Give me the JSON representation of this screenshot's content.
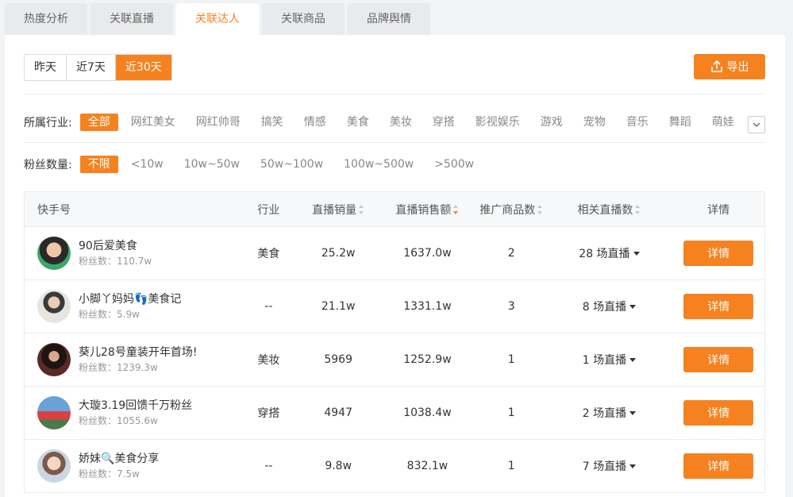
{
  "tabs": [
    {
      "label": "热度分析",
      "active": false
    },
    {
      "label": "关联直播",
      "active": false
    },
    {
      "label": "关联达人",
      "active": true
    },
    {
      "label": "关联商品",
      "active": false
    },
    {
      "label": "品牌舆情",
      "active": false
    }
  ],
  "date_range": {
    "options": [
      "昨天",
      "近7天",
      "近30天"
    ],
    "selected": "近30天"
  },
  "export_label": "导出",
  "industry_filter": {
    "label": "所属行业:",
    "options": [
      "全部",
      "网红美女",
      "网红帅哥",
      "搞笑",
      "情感",
      "美食",
      "美妆",
      "穿搭",
      "影视娱乐",
      "游戏",
      "宠物",
      "音乐",
      "舞蹈",
      "萌娃"
    ],
    "selected": "全部"
  },
  "fans_filter": {
    "label": "粉丝数量:",
    "options": [
      "不限",
      "<10w",
      "10w~50w",
      "50w~100w",
      "100w~500w",
      ">500w"
    ],
    "selected": "不限"
  },
  "table": {
    "headers": [
      "快手号",
      "行业",
      "直播销量",
      "直播销售额",
      "推广商品数",
      "相关直播数",
      "详情"
    ],
    "sorted_column": "直播销售额",
    "rows": [
      {
        "name": "90后爱美食",
        "fans": "粉丝数：110.7w",
        "industry": "美食",
        "sales": "25.2w",
        "revenue": "1637.0w",
        "products": "2",
        "lives": "28 场直播",
        "detail": "详情"
      },
      {
        "name": "小脚丫妈妈👣美食记",
        "fans": "粉丝数：5.9w",
        "industry": "--",
        "sales": "21.1w",
        "revenue": "1331.1w",
        "products": "3",
        "lives": "8 场直播",
        "detail": "详情"
      },
      {
        "name": "葵儿28号童装开年首场!",
        "fans": "粉丝数：1239.3w",
        "industry": "美妆",
        "sales": "5969",
        "revenue": "1252.9w",
        "products": "1",
        "lives": "1 场直播",
        "detail": "详情"
      },
      {
        "name": "大璇3.19回馈千万粉丝",
        "fans": "粉丝数：1055.6w",
        "industry": "穿搭",
        "sales": "4947",
        "revenue": "1038.4w",
        "products": "1",
        "lives": "2 场直播",
        "detail": "详情"
      },
      {
        "name": "娇妹🔍美食分享",
        "fans": "粉丝数：7.5w",
        "industry": "--",
        "sales": "9.8w",
        "revenue": "832.1w",
        "products": "1",
        "lives": "7 场直播",
        "detail": "详情"
      }
    ]
  },
  "colors": {
    "accent": "#f5821f",
    "panel": "#ffffff",
    "background": "#f2f3f5"
  }
}
